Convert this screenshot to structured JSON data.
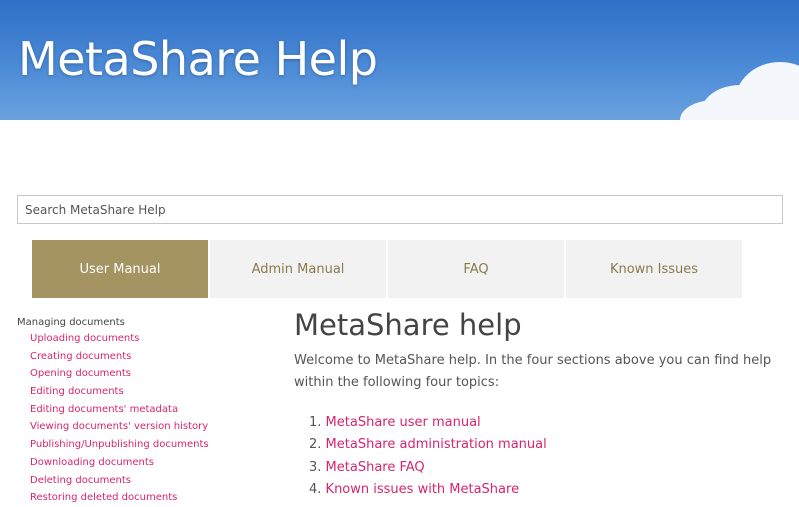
{
  "banner": {
    "title": "MetaShare Help"
  },
  "search": {
    "placeholder": "Search MetaShare Help"
  },
  "tabs": [
    {
      "label": "User Manual",
      "active": true
    },
    {
      "label": "Admin Manual",
      "active": false
    },
    {
      "label": "FAQ",
      "active": false
    },
    {
      "label": "Known Issues",
      "active": false
    }
  ],
  "sidebar": {
    "header": "Managing documents",
    "items": [
      "Uploading documents",
      "Creating documents",
      "Opening documents",
      "Editing documents",
      "Editing documents' metadata",
      "Viewing documents' version history",
      "Publishing/Unpublishing documents",
      "Downloading documents",
      "Deleting documents",
      "Restoring deleted documents"
    ]
  },
  "main": {
    "title": "MetaShare help",
    "intro": "Welcome to MetaShare help. In the four sections above you can find help within the following four topics:",
    "topics": [
      {
        "num": "1.",
        "label": "MetaShare user manual"
      },
      {
        "num": "2.",
        "label": "MetaShare administration manual"
      },
      {
        "num": "3.",
        "label": "MetaShare FAQ"
      },
      {
        "num": "4.",
        "label": "Known issues with MetaShare"
      }
    ]
  },
  "colors": {
    "accent": "#a39462",
    "link": "#d6246e",
    "tab_bg": "#f2f2f2",
    "tab_text": "#8c7a4e"
  }
}
